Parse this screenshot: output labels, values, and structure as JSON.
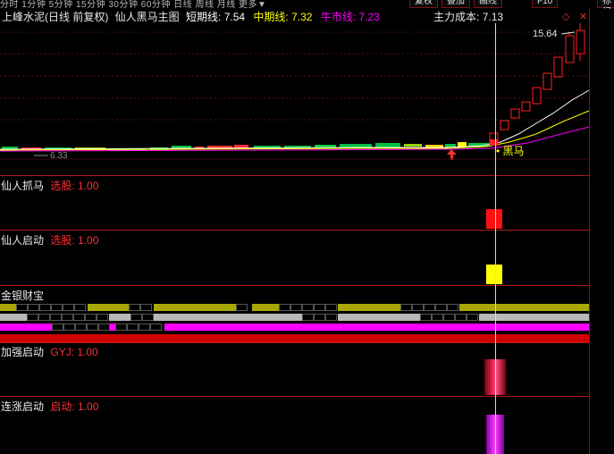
{
  "top_menu": {
    "periods_text": "分时  1分钟  5分钟  15分钟  30分钟  60分钟  日线  周线  月线  更多▼",
    "tabs": [
      "复权",
      "叠加",
      "画线",
      "F10",
      "标记"
    ]
  },
  "main_panel": {
    "stock_title": "上峰水泥(日线 前复权)",
    "formula_name": "仙人黑马主图",
    "short_label": "短期线:",
    "short_value": "7.54",
    "mid_label": "中期线:",
    "mid_value": "7.32",
    "bull_label": "牛市线:",
    "bull_value": "7.23",
    "cost_label": "主力成本:",
    "cost_value": "7.13",
    "high_label": "15.64",
    "low_label": "6.33",
    "signal_label": "黑马",
    "colors": {
      "short": "#ffffff",
      "mid": "#ffff00",
      "bull": "#ff00ff",
      "up": "#ff2020",
      "down": "#00d040"
    }
  },
  "panel_xianren_zhuama": {
    "title": "仙人抓马",
    "label": "选股:",
    "value": "1.00",
    "bar_color": "#ff1010"
  },
  "panel_xianren_qidong": {
    "title": "仙人启动",
    "label": "选股:",
    "value": "1.00",
    "bar_color": "#ffff00"
  },
  "panel_jinyin": {
    "title": "金银财宝",
    "row_colors": [
      "#a8a800",
      "#b8b8b8",
      "#ff00ff",
      "#d00000"
    ]
  },
  "panel_jiaqiang": {
    "title": "加强启动",
    "label": "GYJ:",
    "value": "1.00",
    "bar_color": "#c01030"
  },
  "panel_lianzhang": {
    "title": "连涨启动",
    "label": "启动:",
    "value": "1.00",
    "bar_color": "#c000c0"
  }
}
